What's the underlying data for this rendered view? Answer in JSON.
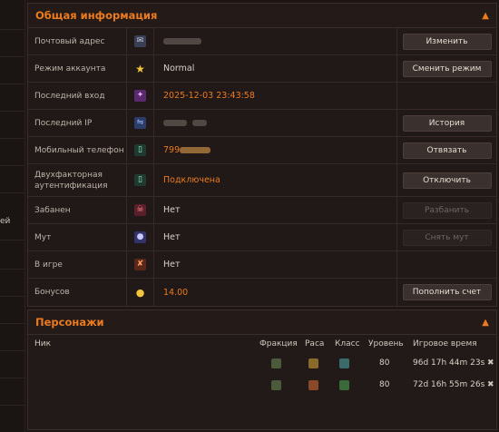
{
  "left_fragment": "ей",
  "info": {
    "title": "Общая информация",
    "rows": [
      {
        "label": "Почтовый адрес",
        "value": "",
        "button": "Изменить",
        "icon": "email-icon"
      },
      {
        "label": "Режим аккаунта",
        "value": "Normal",
        "button": "Сменить режим",
        "icon": "star-icon"
      },
      {
        "label": "Последний вход",
        "value": "2025-12-03 23:43:58",
        "button": "",
        "icon": "login-icon"
      },
      {
        "label": "Последний IP",
        "value": "",
        "button": "История",
        "icon": "network-icon"
      },
      {
        "label": "Мобильный телефон",
        "value": "799",
        "button": "Отвязать",
        "icon": "phone-icon"
      },
      {
        "label": "Двухфакторная аутентификация",
        "value": "Подключена",
        "button": "Отключить",
        "icon": "twofa-icon"
      },
      {
        "label": "Забанен",
        "value": "Нет",
        "button": "Разбанить",
        "icon": "ban-icon"
      },
      {
        "label": "Мут",
        "value": "Нет",
        "button": "Снять мут",
        "icon": "mute-icon"
      },
      {
        "label": "В игре",
        "value": "Нет",
        "button": "",
        "icon": "ingame-icon"
      },
      {
        "label": "Бонусов",
        "value": "14.00",
        "button": "Пополнить счет",
        "icon": "coin-icon"
      }
    ]
  },
  "characters": {
    "title": "Персонажи",
    "columns": {
      "nick": "Ник",
      "faction": "Фракция",
      "race": "Раса",
      "class": "Класс",
      "level": "Уровень",
      "playtime": "Игровое время"
    },
    "rows": [
      {
        "level": "80",
        "playtime": "96d 17h 44m 23s"
      },
      {
        "level": "80",
        "playtime": "72d 16h 55m 26s"
      }
    ]
  },
  "colors": {
    "accent": "#ec7a1e",
    "background": "#1d1615"
  }
}
